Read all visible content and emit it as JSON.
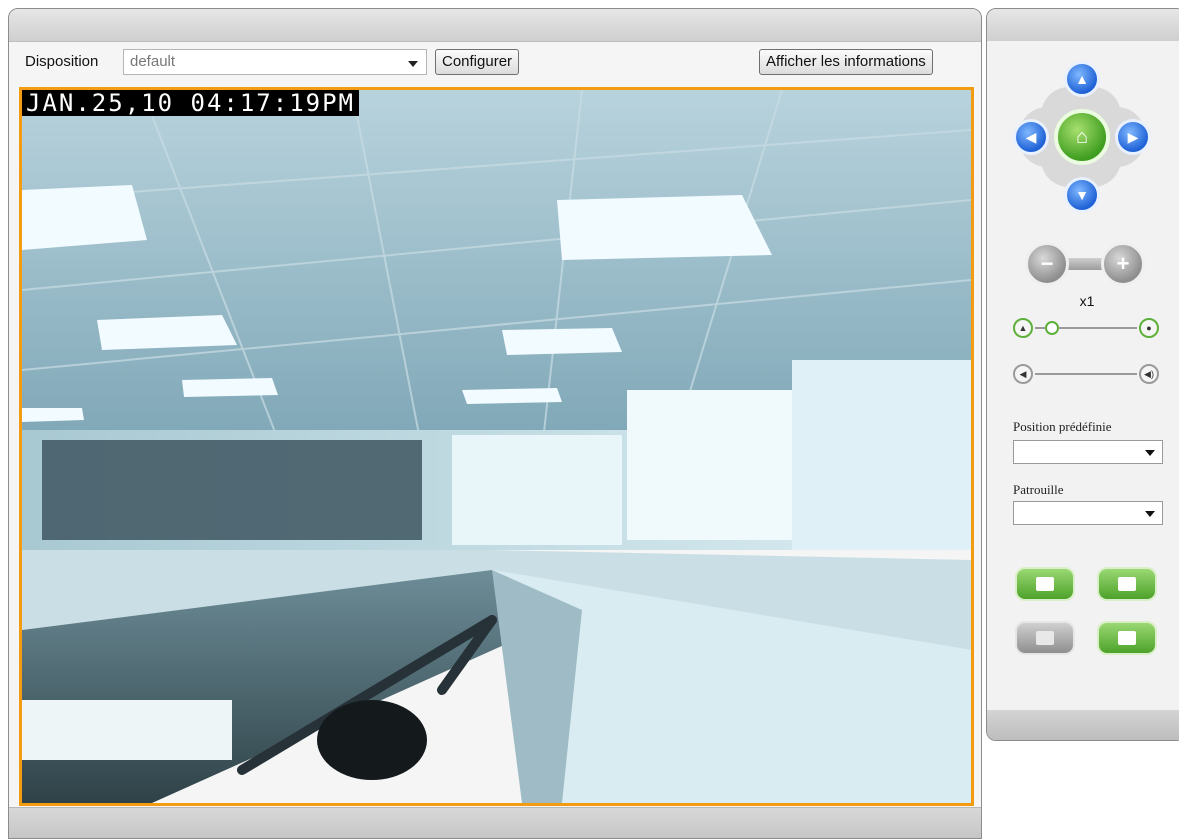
{
  "toolbar": {
    "layout_label": "Disposition",
    "layout_value": "default",
    "configure_button": "Configurer",
    "show_info_button": "Afficher les informations"
  },
  "video": {
    "timestamp": "JAN.25,10 04:17:19PM",
    "frame_color": "#f39c12"
  },
  "controls": {
    "zoom_level": "x1",
    "preset_label": "Position prédéfinie",
    "preset_value": "",
    "patrol_label": "Patrouille",
    "patrol_value": "",
    "colors": {
      "nav_blue": "#1f62d6",
      "home_green": "#3f9e1f",
      "action_green": "#4da22a"
    }
  }
}
